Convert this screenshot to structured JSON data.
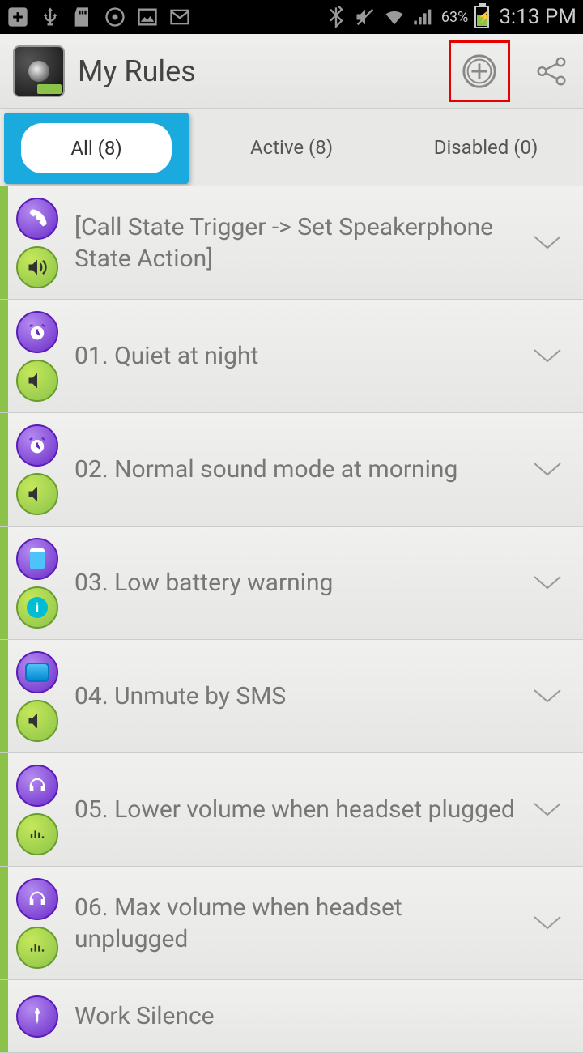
{
  "status": {
    "battery_pct": "63%",
    "time": "3:13 PM"
  },
  "header": {
    "title": "My Rules"
  },
  "tabs": {
    "all": "All (8)",
    "active": "Active (8)",
    "disabled": "Disabled (0)"
  },
  "rules": [
    {
      "title": "[Call State Trigger -> Set Speakerphone State Action]"
    },
    {
      "title": "01. Quiet at night"
    },
    {
      "title": "02. Normal sound mode at morning"
    },
    {
      "title": "03. Low battery warning"
    },
    {
      "title": "04. Unmute by SMS"
    },
    {
      "title": "05. Lower volume when headset plugged"
    },
    {
      "title": "06. Max volume when headset unplugged"
    },
    {
      "title": "Work Silence"
    }
  ]
}
